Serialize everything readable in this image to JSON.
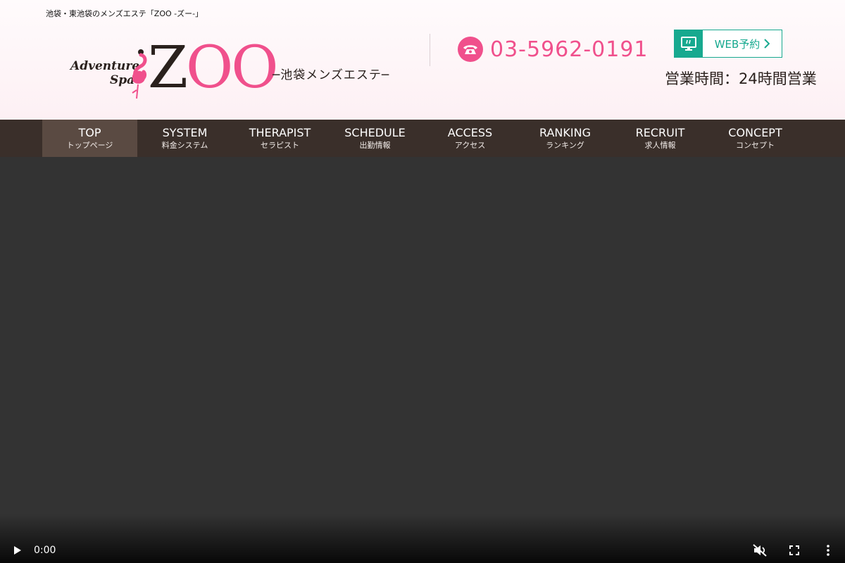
{
  "header": {
    "tagline": "池袋・東池袋のメンズエステ「ZOO -ズー-」",
    "logo": {
      "script_line1": "Adventure",
      "script_line2": "Spa",
      "zoo_z": "Z",
      "zoo_oo": "OO",
      "subtitle": "─池袋メンズエステ─"
    },
    "phone": "03-5962-0191",
    "web_button": "WEB予約",
    "hours": "営業時間：24時間営業"
  },
  "nav": [
    {
      "en": "TOP",
      "jp": "トップページ",
      "active": true
    },
    {
      "en": "SYSTEM",
      "jp": "料金システム",
      "active": false
    },
    {
      "en": "THERAPIST",
      "jp": "セラピスト",
      "active": false
    },
    {
      "en": "SCHEDULE",
      "jp": "出勤情報",
      "active": false
    },
    {
      "en": "ACCESS",
      "jp": "アクセス",
      "active": false
    },
    {
      "en": "RANKING",
      "jp": "ランキング",
      "active": false
    },
    {
      "en": "RECRUIT",
      "jp": "求人情報",
      "active": false
    },
    {
      "en": "CONCEPT",
      "jp": "コンセプト",
      "active": false
    }
  ],
  "video": {
    "time": "0:00"
  },
  "colors": {
    "brand_pink": "#f0508c",
    "brand_dark": "#2a211d",
    "accent_green": "#17a98f",
    "nav_bg": "#3a2f2a",
    "nav_active": "#5a4a42"
  },
  "icons": {
    "phone": "phone-icon",
    "web": "monitor-icon",
    "play": "play-icon",
    "mute": "muted-speaker-icon",
    "fullscreen": "fullscreen-icon",
    "more": "more-vertical-icon"
  }
}
